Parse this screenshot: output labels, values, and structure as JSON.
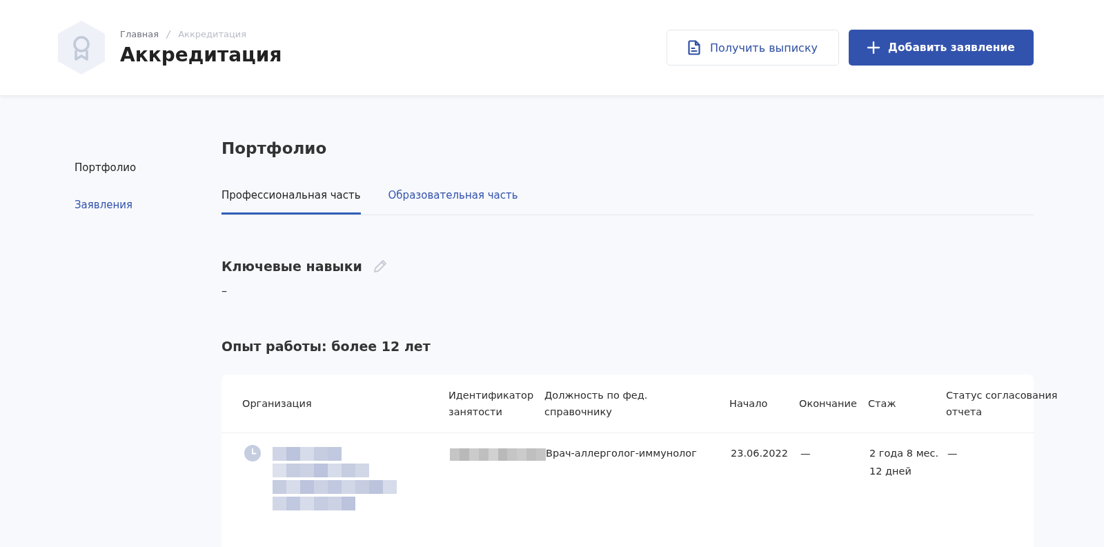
{
  "breadcrumbs": [
    {
      "label": "Главная",
      "current": false
    },
    {
      "label": "Аккредитация",
      "current": true
    }
  ],
  "page_title": "Аккредитация",
  "header_buttons": [
    {
      "label": "Получить выписку",
      "kind": "secondary"
    },
    {
      "label": "Добавить заявление",
      "kind": "primary"
    }
  ],
  "sidebar": {
    "items": [
      {
        "label": "Портфолио",
        "selected": true
      },
      {
        "label": "Заявления",
        "selected": false
      }
    ]
  },
  "section_title": "Портфолио",
  "tabs": [
    {
      "label": "Профессиональная часть",
      "selected": true
    },
    {
      "label": "Образовательная часть",
      "selected": false
    }
  ],
  "key_skills": {
    "title": "Ключевые навыки",
    "value": "–"
  },
  "experience_title": "Опыт работы: более 12 лет",
  "table": {
    "columns": [
      "Организация",
      "Идентификатор занятости",
      "Должность по фед. справочнику",
      "Начало",
      "Окончание",
      "Стаж",
      "Статус согласования отчета"
    ],
    "rows": [
      {
        "position": "Врач-аллерголог-иммунолог",
        "start": "23.06.2022",
        "end": "—",
        "tenure": "2 года 8 мес. 12 дней",
        "status": "—"
      }
    ]
  }
}
